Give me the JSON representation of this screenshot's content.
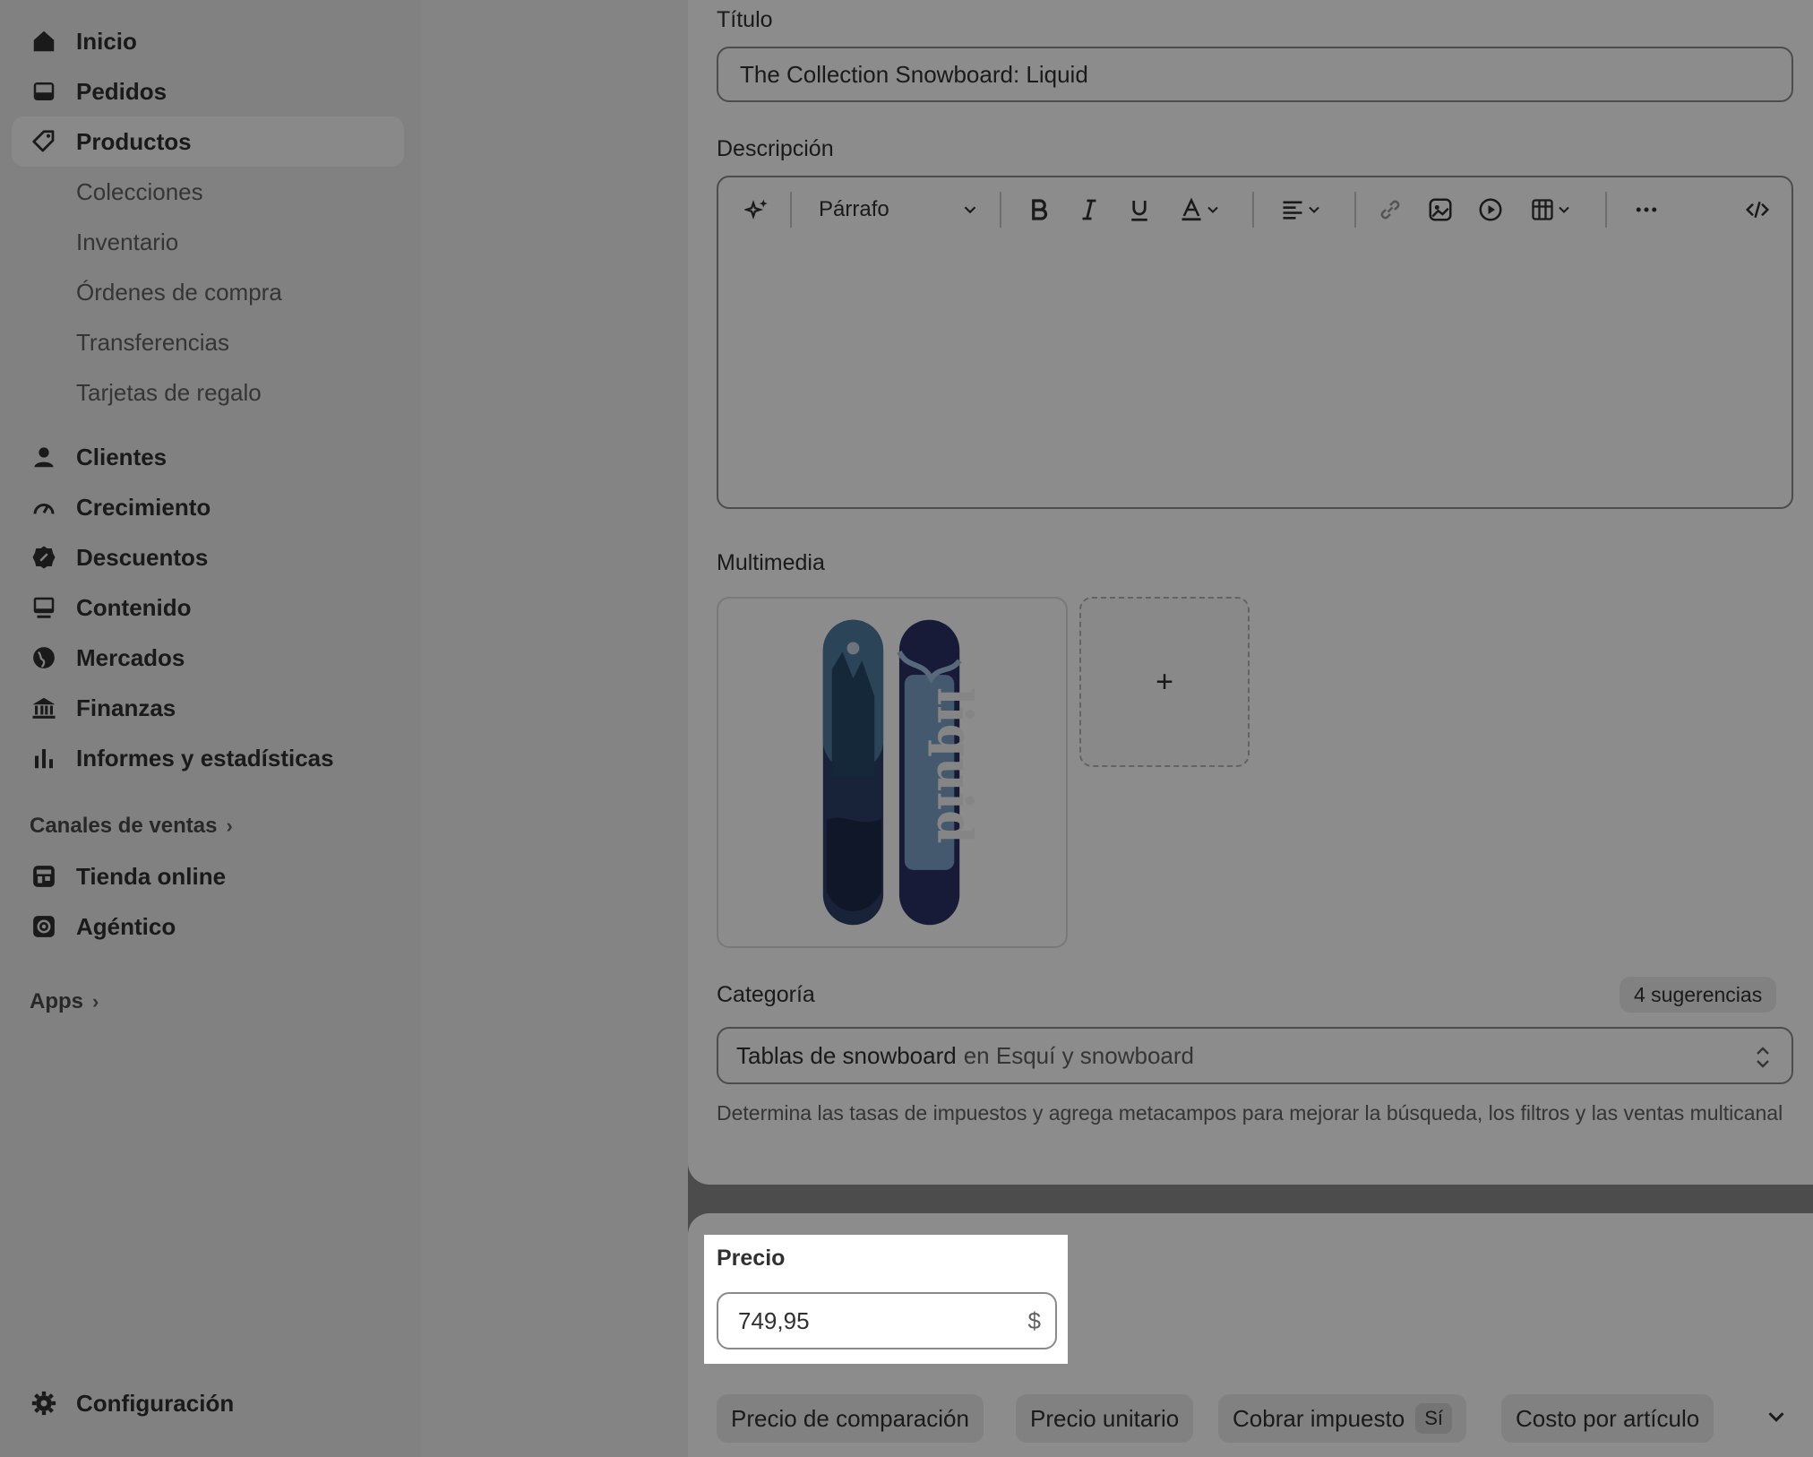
{
  "sidebar": {
    "nav": [
      {
        "label": "Inicio",
        "icon": "home-icon"
      },
      {
        "label": "Pedidos",
        "icon": "inbox-icon"
      },
      {
        "label": "Productos",
        "icon": "tag-icon"
      }
    ],
    "products_sub": [
      "Colecciones",
      "Inventario",
      "Órdenes de compra",
      "Transferencias",
      "Tarjetas de regalo"
    ],
    "nav2": [
      {
        "label": "Clientes",
        "icon": "person-icon"
      },
      {
        "label": "Crecimiento",
        "icon": "gauge-icon"
      },
      {
        "label": "Descuentos",
        "icon": "discount-icon"
      },
      {
        "label": "Contenido",
        "icon": "content-icon"
      },
      {
        "label": "Mercados",
        "icon": "globe-icon"
      },
      {
        "label": "Finanzas",
        "icon": "bank-icon"
      },
      {
        "label": "Informes y estadísticas",
        "icon": "bar-chart-icon"
      }
    ],
    "sales_channels_heading": "Canales de ventas",
    "channels": [
      {
        "label": "Tienda online",
        "icon": "store-icon"
      },
      {
        "label": "Agéntico",
        "icon": "agent-icon"
      }
    ],
    "apps_heading": "Apps",
    "settings_label": "Configuración"
  },
  "product": {
    "title_label": "Título",
    "title_value": "The Collection Snowboard: Liquid",
    "description_label": "Descripción",
    "editor_paragraph": "Párrafo",
    "media_label": "Multimedia",
    "media_add": "+",
    "category_label": "Categoría",
    "category_suggestions": "4 sugerencias",
    "category_value": "Tablas de snowboard",
    "category_context": "en Esquí y snowboard",
    "category_helper": "Determina las tasas de impuestos y agrega metacampos para mejorar la búsqueda, los filtros y las ventas multicanal",
    "board_print": "liquid"
  },
  "pricing": {
    "price_label": "Precio",
    "price_value": "749,95",
    "currency": "$",
    "pills": [
      "Precio de comparación",
      "Precio unitario",
      "Cobrar impuesto",
      "Costo por artículo"
    ],
    "tax_value": "Sí"
  }
}
